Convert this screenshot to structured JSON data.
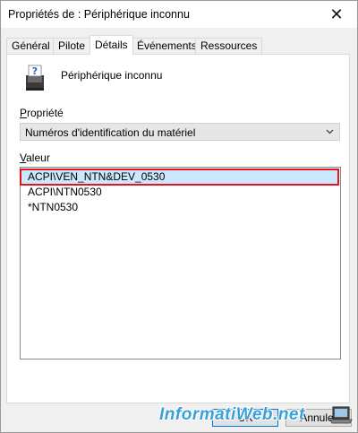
{
  "window": {
    "title": "Propriétés de : Périphérique inconnu"
  },
  "tabs": [
    "Général",
    "Pilote",
    "Détails",
    "Événements",
    "Ressources"
  ],
  "active_tab": "Détails",
  "device": {
    "name": "Périphérique inconnu",
    "icon": "unknown-device-icon"
  },
  "property": {
    "label_underlined": "P",
    "label_rest": "ropriété",
    "selected": "Numéros d'identification du matériel"
  },
  "value": {
    "label_underlined": "V",
    "label_rest": "aleur",
    "items": [
      "ACPI\\VEN_NTN&DEV_0530",
      "ACPI\\NTN0530",
      "*NTN0530"
    ],
    "selected_index": 0
  },
  "buttons": {
    "ok": "OK",
    "cancel": "Annuler"
  },
  "watermark": "InformatiWeb.net",
  "colors": {
    "highlight": "#e8141c",
    "selection": "#cce8ff",
    "accent": "#0078d7"
  }
}
